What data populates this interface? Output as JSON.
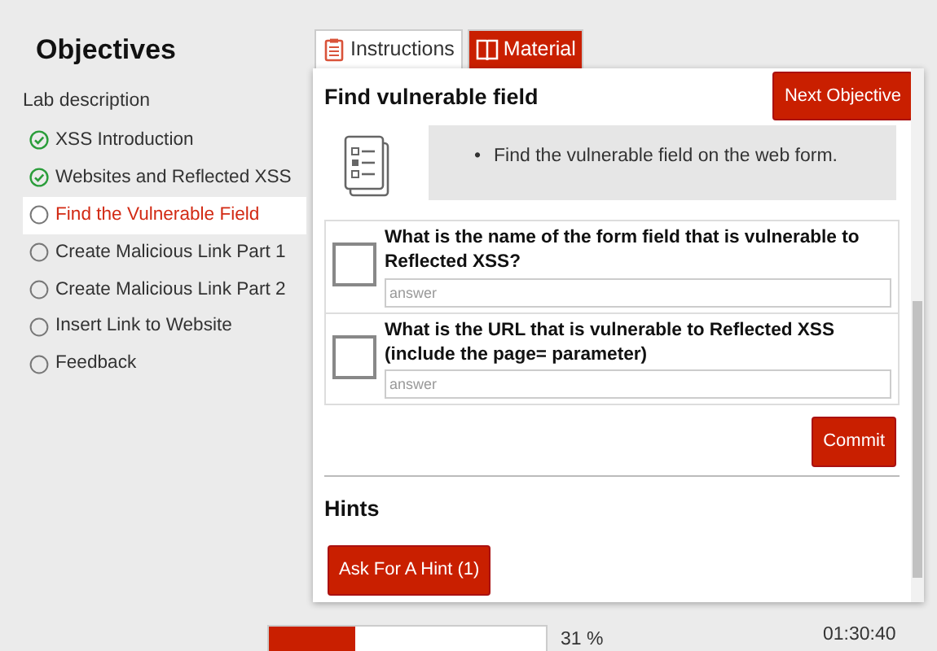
{
  "sidebar": {
    "title": "Objectives",
    "subtitle": "Lab description",
    "items": [
      {
        "label": "XSS Introduction",
        "completed": true,
        "selected": false
      },
      {
        "label": "Websites and Reflected XSS",
        "completed": true,
        "selected": false
      },
      {
        "label": "Find the Vulnerable Field",
        "completed": false,
        "selected": true
      },
      {
        "label": "Create Malicious Link Part 1",
        "completed": false,
        "selected": false
      },
      {
        "label": "Create Malicious Link Part 2",
        "completed": false,
        "selected": false
      },
      {
        "label": "Insert Link to Website",
        "completed": false,
        "selected": false
      },
      {
        "label": "Feedback",
        "completed": false,
        "selected": false
      }
    ]
  },
  "tabs": [
    {
      "label": "Instructions",
      "kind": "instructions",
      "selected": true
    },
    {
      "label": "Material",
      "kind": "material",
      "selected": false
    }
  ],
  "panel": {
    "title": "Find vulnerable field",
    "next_button": "Next Objective",
    "instructions": [
      {
        "marker": "•",
        "text": "Find the vulnerable field on the web form."
      }
    ],
    "questions": [
      {
        "text": "What is the name of the form field that is vulnerable to Reflected XSS?",
        "placeholder": "answer",
        "checked": false
      },
      {
        "text": "What is the URL that is vulnerable to Reflected XSS (include the page= parameter)",
        "placeholder": "answer",
        "checked": false
      }
    ],
    "commit_button": "Commit",
    "hints_title": "Hints",
    "hint_button": "Ask For A Hint (1)"
  },
  "progress": {
    "level": 0.31,
    "reading": "31 %"
  },
  "timer": "01:30:40"
}
